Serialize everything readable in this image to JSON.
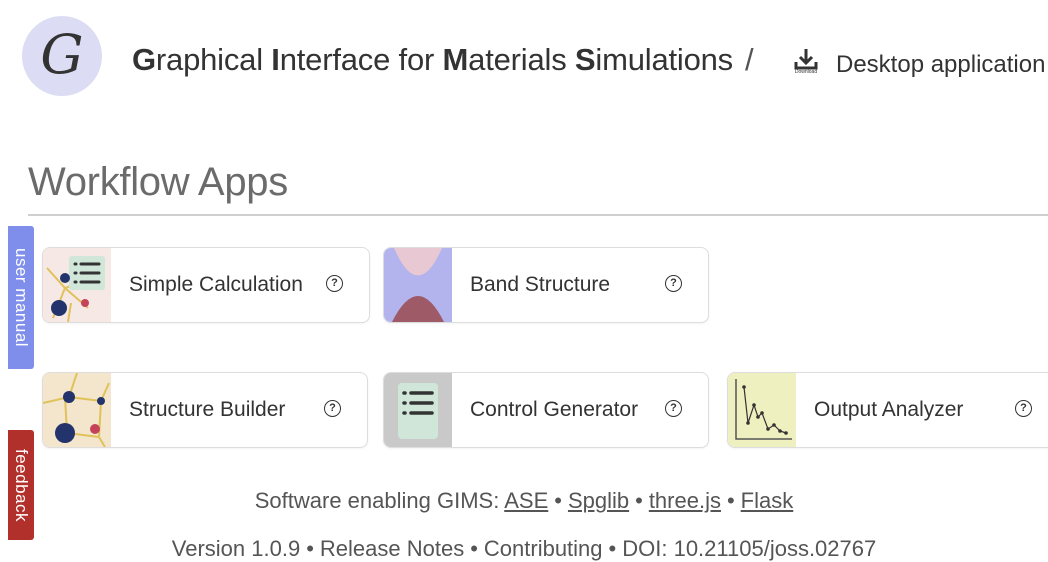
{
  "header": {
    "logo_letter": "G",
    "title_parts": [
      {
        "b": "G",
        "t": "raphical "
      },
      {
        "b": "I",
        "t": "nterface for "
      },
      {
        "b": "M",
        "t": "aterials "
      },
      {
        "b": "S",
        "t": "imulations"
      }
    ],
    "separator": "/",
    "download_icon_caption": "Download",
    "desktop_label": "Desktop application"
  },
  "section_title": "Workflow Apps",
  "side_tabs": {
    "manual": "user manual",
    "feedback": "feedback"
  },
  "apps": [
    {
      "label": "Simple Calculation",
      "help": "?"
    },
    {
      "label": "Band Structure",
      "help": "?"
    },
    {
      "label": "Structure Builder",
      "help": "?"
    },
    {
      "label": "Control Generator",
      "help": "?"
    },
    {
      "label": "Output Analyzer",
      "help": "?"
    }
  ],
  "footer": {
    "software_prefix": "Software enabling GIMS: ",
    "links": [
      "ASE",
      "Spglib",
      "three.js",
      "Flask"
    ],
    "bullet": "•",
    "version_items": [
      "Version 1.0.9",
      "Release Notes",
      "Contributing",
      "DOI: 10.21105/joss.02767"
    ]
  },
  "colors": {
    "logo_bg": "#dcdcf5",
    "manual_tab": "#7f8eea",
    "feedback_tab": "#b2302c",
    "band_blue": "#b3b3ee",
    "band_red": "#9e5a66"
  }
}
